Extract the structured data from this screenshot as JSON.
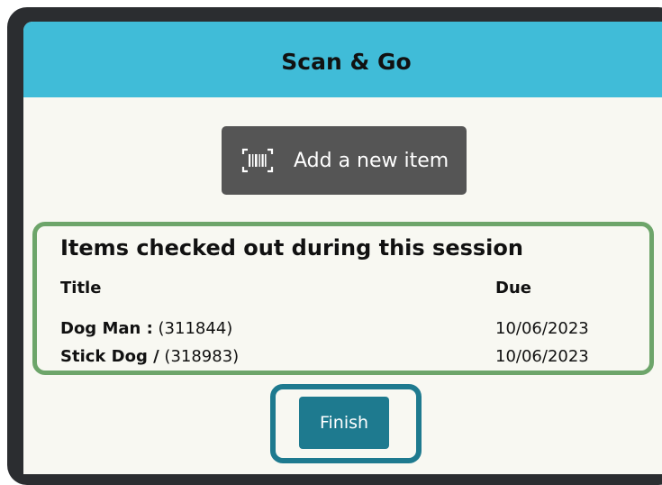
{
  "header": {
    "title": "Scan & Go"
  },
  "add_item": {
    "label": "Add a new item",
    "icon": "barcode-scan-icon"
  },
  "session": {
    "heading": "Items checked out during this session",
    "columns": {
      "title": "Title",
      "due": "Due"
    },
    "items": [
      {
        "name": "Dog Man :",
        "id": "(311844)",
        "due": "10/06/2023"
      },
      {
        "name": "Stick Dog /",
        "id": "(318983)",
        "due": "10/06/2023"
      }
    ]
  },
  "finish": {
    "label": "Finish"
  },
  "colors": {
    "header_bg": "#40bcd8",
    "add_button_bg": "#555555",
    "session_highlight": "#6da56a",
    "finish_bg": "#1e7a8f",
    "finish_highlight": "#1e7a8f"
  }
}
